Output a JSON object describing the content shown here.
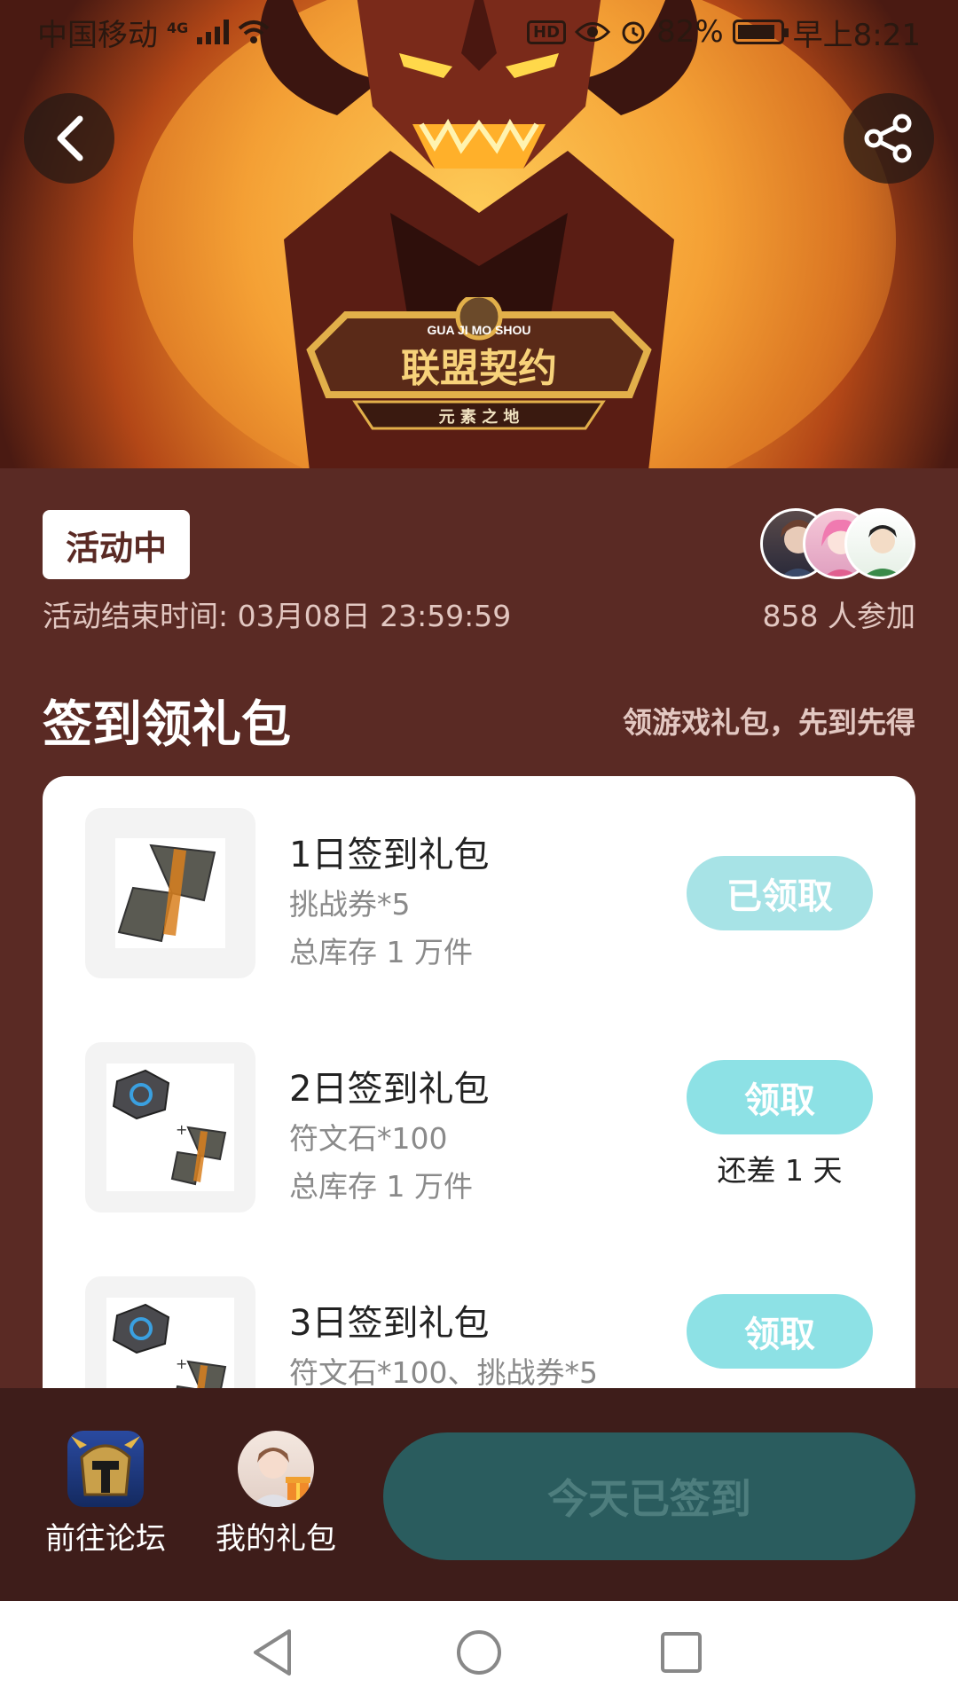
{
  "status_bar": {
    "carrier": "中国移动",
    "network": "4G",
    "hd": "HD",
    "battery": "82%",
    "time": "早上8:21"
  },
  "banner": {
    "logo_top": "GUA JI MO SHOU",
    "logo_title": "联盟契约",
    "logo_sub": "元  素  之  地"
  },
  "activity": {
    "status": "活动中",
    "end_time": "活动结束时间: 03月08日 23:59:59",
    "participants": "858 人参加"
  },
  "section": {
    "title": "签到领礼包",
    "subtitle": "领游戏礼包，先到先得"
  },
  "gifts": [
    {
      "name": "1日签到礼包",
      "desc": "挑战券*5",
      "stock": "总库存 1 万件",
      "button": "已领取",
      "note": ""
    },
    {
      "name": "2日签到礼包",
      "desc": "符文石*100",
      "stock": "总库存 1 万件",
      "button": "领取",
      "note": "还差 1 天"
    },
    {
      "name": "3日签到礼包",
      "desc": "符文石*100、挑战券*5",
      "stock": "",
      "button": "领取",
      "note": ""
    }
  ],
  "bottom": {
    "forum_label": "前往论坛",
    "gifts_label": "我的礼包",
    "signed_label": "今天已签到"
  },
  "icons": {
    "back": "back-arrow-icon",
    "share": "share-icon",
    "nav_back": "triangle-back-icon",
    "nav_home": "circle-home-icon",
    "nav_recent": "square-recent-icon"
  },
  "colors": {
    "background": "#5a2a24",
    "accent": "#8de1e5",
    "signed_button": "#2a5c5e",
    "bottom_bar": "#3e1d1a"
  }
}
